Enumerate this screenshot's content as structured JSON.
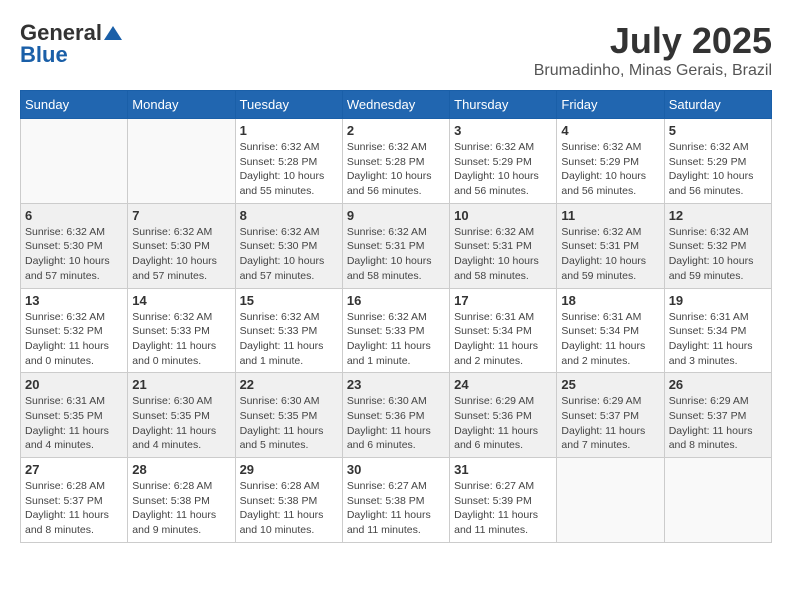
{
  "header": {
    "logo_general": "General",
    "logo_blue": "Blue",
    "month_year": "July 2025",
    "location": "Brumadinho, Minas Gerais, Brazil"
  },
  "calendar": {
    "days_of_week": [
      "Sunday",
      "Monday",
      "Tuesday",
      "Wednesday",
      "Thursday",
      "Friday",
      "Saturday"
    ],
    "weeks": [
      {
        "shaded": false,
        "days": [
          {
            "number": "",
            "info": ""
          },
          {
            "number": "",
            "info": ""
          },
          {
            "number": "1",
            "info": "Sunrise: 6:32 AM\nSunset: 5:28 PM\nDaylight: 10 hours and 55 minutes."
          },
          {
            "number": "2",
            "info": "Sunrise: 6:32 AM\nSunset: 5:28 PM\nDaylight: 10 hours and 56 minutes."
          },
          {
            "number": "3",
            "info": "Sunrise: 6:32 AM\nSunset: 5:29 PM\nDaylight: 10 hours and 56 minutes."
          },
          {
            "number": "4",
            "info": "Sunrise: 6:32 AM\nSunset: 5:29 PM\nDaylight: 10 hours and 56 minutes."
          },
          {
            "number": "5",
            "info": "Sunrise: 6:32 AM\nSunset: 5:29 PM\nDaylight: 10 hours and 56 minutes."
          }
        ]
      },
      {
        "shaded": true,
        "days": [
          {
            "number": "6",
            "info": "Sunrise: 6:32 AM\nSunset: 5:30 PM\nDaylight: 10 hours and 57 minutes."
          },
          {
            "number": "7",
            "info": "Sunrise: 6:32 AM\nSunset: 5:30 PM\nDaylight: 10 hours and 57 minutes."
          },
          {
            "number": "8",
            "info": "Sunrise: 6:32 AM\nSunset: 5:30 PM\nDaylight: 10 hours and 57 minutes."
          },
          {
            "number": "9",
            "info": "Sunrise: 6:32 AM\nSunset: 5:31 PM\nDaylight: 10 hours and 58 minutes."
          },
          {
            "number": "10",
            "info": "Sunrise: 6:32 AM\nSunset: 5:31 PM\nDaylight: 10 hours and 58 minutes."
          },
          {
            "number": "11",
            "info": "Sunrise: 6:32 AM\nSunset: 5:31 PM\nDaylight: 10 hours and 59 minutes."
          },
          {
            "number": "12",
            "info": "Sunrise: 6:32 AM\nSunset: 5:32 PM\nDaylight: 10 hours and 59 minutes."
          }
        ]
      },
      {
        "shaded": false,
        "days": [
          {
            "number": "13",
            "info": "Sunrise: 6:32 AM\nSunset: 5:32 PM\nDaylight: 11 hours and 0 minutes."
          },
          {
            "number": "14",
            "info": "Sunrise: 6:32 AM\nSunset: 5:33 PM\nDaylight: 11 hours and 0 minutes."
          },
          {
            "number": "15",
            "info": "Sunrise: 6:32 AM\nSunset: 5:33 PM\nDaylight: 11 hours and 1 minute."
          },
          {
            "number": "16",
            "info": "Sunrise: 6:32 AM\nSunset: 5:33 PM\nDaylight: 11 hours and 1 minute."
          },
          {
            "number": "17",
            "info": "Sunrise: 6:31 AM\nSunset: 5:34 PM\nDaylight: 11 hours and 2 minutes."
          },
          {
            "number": "18",
            "info": "Sunrise: 6:31 AM\nSunset: 5:34 PM\nDaylight: 11 hours and 2 minutes."
          },
          {
            "number": "19",
            "info": "Sunrise: 6:31 AM\nSunset: 5:34 PM\nDaylight: 11 hours and 3 minutes."
          }
        ]
      },
      {
        "shaded": true,
        "days": [
          {
            "number": "20",
            "info": "Sunrise: 6:31 AM\nSunset: 5:35 PM\nDaylight: 11 hours and 4 minutes."
          },
          {
            "number": "21",
            "info": "Sunrise: 6:30 AM\nSunset: 5:35 PM\nDaylight: 11 hours and 4 minutes."
          },
          {
            "number": "22",
            "info": "Sunrise: 6:30 AM\nSunset: 5:35 PM\nDaylight: 11 hours and 5 minutes."
          },
          {
            "number": "23",
            "info": "Sunrise: 6:30 AM\nSunset: 5:36 PM\nDaylight: 11 hours and 6 minutes."
          },
          {
            "number": "24",
            "info": "Sunrise: 6:29 AM\nSunset: 5:36 PM\nDaylight: 11 hours and 6 minutes."
          },
          {
            "number": "25",
            "info": "Sunrise: 6:29 AM\nSunset: 5:37 PM\nDaylight: 11 hours and 7 minutes."
          },
          {
            "number": "26",
            "info": "Sunrise: 6:29 AM\nSunset: 5:37 PM\nDaylight: 11 hours and 8 minutes."
          }
        ]
      },
      {
        "shaded": false,
        "days": [
          {
            "number": "27",
            "info": "Sunrise: 6:28 AM\nSunset: 5:37 PM\nDaylight: 11 hours and 8 minutes."
          },
          {
            "number": "28",
            "info": "Sunrise: 6:28 AM\nSunset: 5:38 PM\nDaylight: 11 hours and 9 minutes."
          },
          {
            "number": "29",
            "info": "Sunrise: 6:28 AM\nSunset: 5:38 PM\nDaylight: 11 hours and 10 minutes."
          },
          {
            "number": "30",
            "info": "Sunrise: 6:27 AM\nSunset: 5:38 PM\nDaylight: 11 hours and 11 minutes."
          },
          {
            "number": "31",
            "info": "Sunrise: 6:27 AM\nSunset: 5:39 PM\nDaylight: 11 hours and 11 minutes."
          },
          {
            "number": "",
            "info": ""
          },
          {
            "number": "",
            "info": ""
          }
        ]
      }
    ]
  }
}
